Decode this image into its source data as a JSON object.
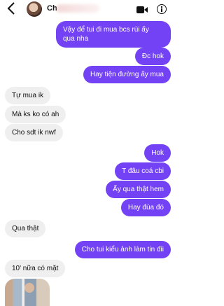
{
  "header": {
    "contact_name": "Ch"
  },
  "messages": [
    {
      "side": "out",
      "lines": [
        "Vậy để tui đi mua bcs rùi ấy",
        "qua nha"
      ]
    },
    {
      "side": "out",
      "text": "Đc hok"
    },
    {
      "side": "out",
      "text": "Hay tiện đường ấy mua"
    },
    {
      "side": "in",
      "text": "Tự mua ik"
    },
    {
      "side": "in",
      "text": "Mà ks ko có ah"
    },
    {
      "side": "in",
      "text": "Cho sdt ik nwf"
    },
    {
      "side": "out",
      "text": "Hok"
    },
    {
      "side": "out",
      "text": "T đâu coá cbi"
    },
    {
      "side": "out",
      "text": "Ấy qua thật hem"
    },
    {
      "side": "out",
      "text": "Hay đùa đó"
    },
    {
      "side": "in",
      "text": "Qua thật"
    },
    {
      "side": "out",
      "text": "Cho tui kiểu ảnh làm tin đii"
    },
    {
      "side": "in",
      "text": "10' nữa có mặt"
    }
  ],
  "colors": {
    "outgoing_bubble": "#7442f5",
    "incoming_bubble": "#efefef"
  },
  "icons": [
    "back-chevron-icon",
    "video-call-icon",
    "info-icon"
  ]
}
